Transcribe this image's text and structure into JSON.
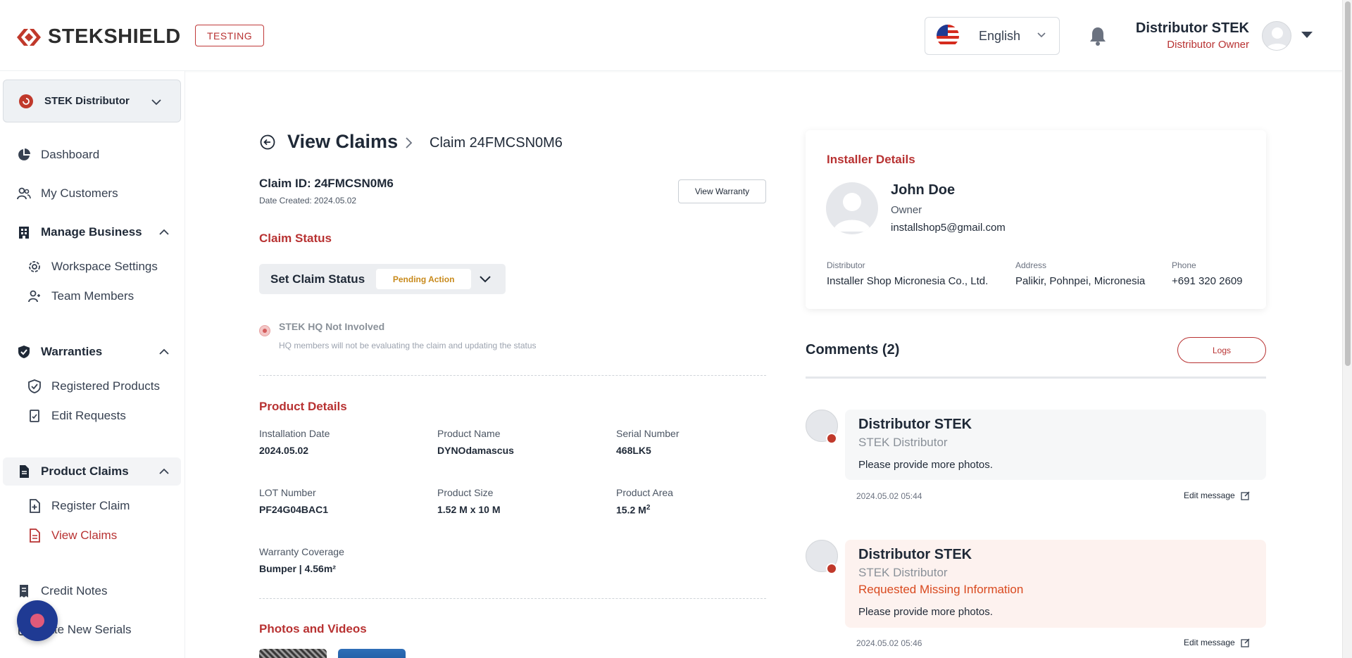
{
  "header": {
    "logo_text": "STEKSHIELD",
    "env_badge": "TESTING",
    "language": "English",
    "user_name": "Distributor STEK",
    "user_role": "Distributor Owner"
  },
  "sidebar": {
    "org_name": "STEK Distributor",
    "items": [
      {
        "label": "Dashboard",
        "icon": "pie-chart-icon"
      },
      {
        "label": "My Customers",
        "icon": "users-icon"
      },
      {
        "label": "Manage Business",
        "icon": "building-icon"
      },
      {
        "label": "Workspace Settings",
        "icon": "gear-icon"
      },
      {
        "label": "Team Members",
        "icon": "team-icon"
      },
      {
        "label": "Warranties",
        "icon": "shield-check-icon"
      },
      {
        "label": "Registered Products",
        "icon": "shield-outline-icon"
      },
      {
        "label": "Edit Requests",
        "icon": "document-edit-icon"
      },
      {
        "label": "Product Claims",
        "icon": "document-icon"
      },
      {
        "label": "Register Claim",
        "icon": "document-plus-icon"
      },
      {
        "label": "View Claims",
        "icon": "document-list-icon"
      },
      {
        "label": "Credit Notes",
        "icon": "receipt-icon"
      },
      {
        "label": "eate New Serials",
        "icon": "serial-icon"
      }
    ]
  },
  "page": {
    "title": "View Claims",
    "breadcrumb": "Claim 24FMCSN0M6",
    "claim_id": "Claim ID: 24FMCSN0M6",
    "date_created": "Date Created: 2024.05.02",
    "view_warranty": "View Warranty"
  },
  "claim_status": {
    "section_title": "Claim Status",
    "set_label": "Set Claim Status",
    "status_value": "Pending Action",
    "hq_title": "STEK HQ Not Involved",
    "hq_desc": "HQ members will not be evaluating the claim and updating the status"
  },
  "product_details": {
    "section_title": "Product Details",
    "fields": [
      {
        "label": "Installation Date",
        "value": "2024.05.02"
      },
      {
        "label": "Product Name",
        "value": "DYNOdamascus"
      },
      {
        "label": "Serial Number",
        "value": "468LK5"
      },
      {
        "label": "LOT Number",
        "value": "PF24G04BAC1"
      },
      {
        "label": "Product Size",
        "value": "1.52 M x 10 M"
      },
      {
        "label": "Product Area",
        "value": "15.2 M"
      },
      {
        "label": "Warranty Coverage",
        "value": "Bumper | 4.56m²"
      }
    ],
    "area_superscript": "2"
  },
  "photos": {
    "section_title": "Photos and Videos"
  },
  "installer": {
    "section_title": "Installer Details",
    "name": "John Doe",
    "role": "Owner",
    "email": "installshop5@gmail.com",
    "distributor_label": "Distributor",
    "distributor_value": "Installer Shop Micronesia Co., Ltd.",
    "address_label": "Address",
    "address_value": "Palikir, Pohnpei, Micronesia",
    "phone_label": "Phone",
    "phone_value": "+691 320 2609"
  },
  "comments": {
    "title": "Comments (2)",
    "logs_label": "Logs",
    "items": [
      {
        "author": "Distributor STEK",
        "org": "STEK Distributor",
        "status": "",
        "text": "Please provide more photos.",
        "time": "2024.05.02 05:44",
        "edit_label": "Edit message"
      },
      {
        "author": "Distributor STEK",
        "org": "STEK Distributor",
        "status": "Requested Missing Information",
        "text": "Please provide more photos.",
        "time": "2024.05.02 05:46",
        "edit_label": "Edit message"
      }
    ]
  },
  "colors": {
    "brand_red": "#b83232",
    "pending": "#c88a1c",
    "status_orange": "#d94a1f",
    "fab": "#1f3a93"
  }
}
